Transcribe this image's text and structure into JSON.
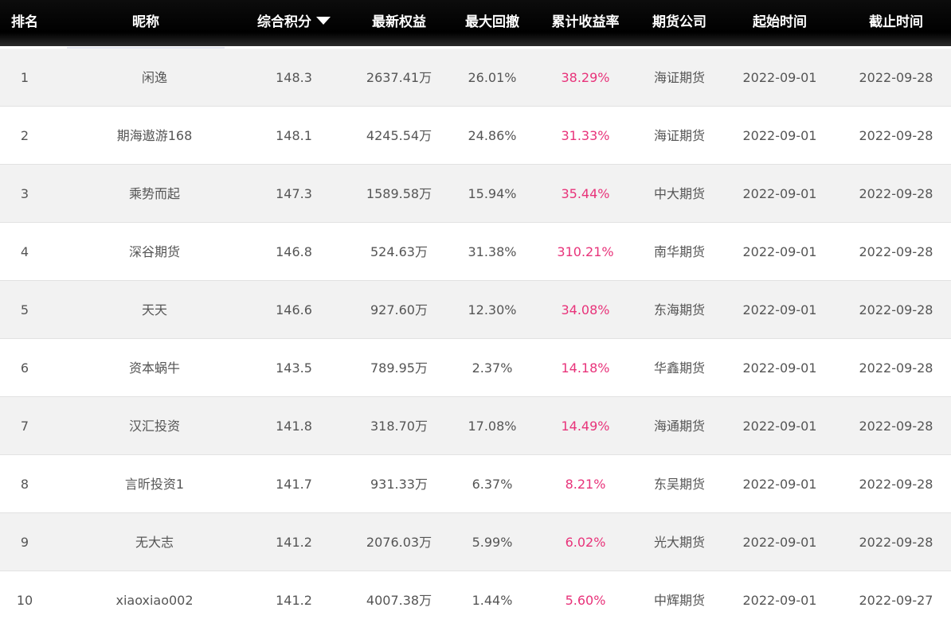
{
  "header": {
    "rank": "排名",
    "nickname": "昵称",
    "score": "综合积分",
    "equity": "最新权益",
    "drawdown": "最大回撤",
    "return": "累计收益率",
    "company": "期货公司",
    "start": "起始时间",
    "end": "截止时间"
  },
  "sort": {
    "column": "综合积分",
    "direction": "descending",
    "icon": "sort-down-triangle-icon"
  },
  "colors": {
    "header_bg": "#000000",
    "header_text": "#ffffff",
    "alt_row_bg": "#f2f2f2",
    "text": "#555555",
    "return_text": "#e8337a"
  },
  "rows": [
    {
      "rank": "1",
      "nickname": "闲逸",
      "score": "148.3",
      "equity": "2637.41万",
      "drawdown": "26.01%",
      "return": "38.29%",
      "company": "海证期货",
      "start": "2022-09-01",
      "end": "2022-09-28"
    },
    {
      "rank": "2",
      "nickname": "期海遨游168",
      "score": "148.1",
      "equity": "4245.54万",
      "drawdown": "24.86%",
      "return": "31.33%",
      "company": "海证期货",
      "start": "2022-09-01",
      "end": "2022-09-28"
    },
    {
      "rank": "3",
      "nickname": "乘势而起",
      "score": "147.3",
      "equity": "1589.58万",
      "drawdown": "15.94%",
      "return": "35.44%",
      "company": "中大期货",
      "start": "2022-09-01",
      "end": "2022-09-28"
    },
    {
      "rank": "4",
      "nickname": "深谷期货",
      "score": "146.8",
      "equity": "524.63万",
      "drawdown": "31.38%",
      "return": "310.21%",
      "company": "南华期货",
      "start": "2022-09-01",
      "end": "2022-09-28"
    },
    {
      "rank": "5",
      "nickname": "天天",
      "score": "146.6",
      "equity": "927.60万",
      "drawdown": "12.30%",
      "return": "34.08%",
      "company": "东海期货",
      "start": "2022-09-01",
      "end": "2022-09-28"
    },
    {
      "rank": "6",
      "nickname": "资本蜗牛",
      "score": "143.5",
      "equity": "789.95万",
      "drawdown": "2.37%",
      "return": "14.18%",
      "company": "华鑫期货",
      "start": "2022-09-01",
      "end": "2022-09-28"
    },
    {
      "rank": "7",
      "nickname": "汉汇投资",
      "score": "141.8",
      "equity": "318.70万",
      "drawdown": "17.08%",
      "return": "14.49%",
      "company": "海通期货",
      "start": "2022-09-01",
      "end": "2022-09-28"
    },
    {
      "rank": "8",
      "nickname": "言昕投资1",
      "score": "141.7",
      "equity": "931.33万",
      "drawdown": "6.37%",
      "return": "8.21%",
      "company": "东吴期货",
      "start": "2022-09-01",
      "end": "2022-09-28"
    },
    {
      "rank": "9",
      "nickname": "无大志",
      "score": "141.2",
      "equity": "2076.03万",
      "drawdown": "5.99%",
      "return": "6.02%",
      "company": "光大期货",
      "start": "2022-09-01",
      "end": "2022-09-28"
    },
    {
      "rank": "10",
      "nickname": "xiaoxiao002",
      "score": "141.2",
      "equity": "4007.38万",
      "drawdown": "1.44%",
      "return": "5.60%",
      "company": "中辉期货",
      "start": "2022-09-01",
      "end": "2022-09-27"
    }
  ]
}
